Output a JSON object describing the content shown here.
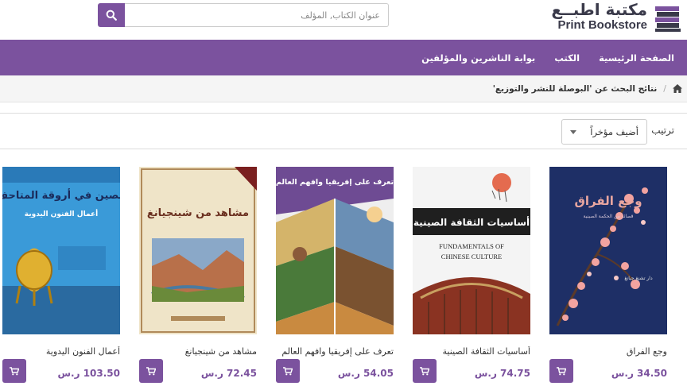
{
  "header": {
    "logo_ar": "مكتبة اطبــع",
    "logo_en": "Print Bookstore",
    "search_placeholder": "عنوان الكتاب, المؤلف"
  },
  "nav": {
    "items": [
      {
        "label": "الصفحة الرئيسية"
      },
      {
        "label": "الكتب"
      },
      {
        "label": "بوابة الناشرين والمؤلفين"
      }
    ]
  },
  "breadcrumb": {
    "current": "نتائج البحث عن 'البوصلة للنشر والتوزيع'"
  },
  "sort": {
    "label": "ترتيب",
    "selected": "أضيف مؤخراً"
  },
  "products": [
    {
      "title": "وجع الفراق",
      "price": "34.50 ر.س",
      "cover_title": "وجع الفراق",
      "cover_subtitle": "قصائد من الحكمة الصينية",
      "cover_author": "دار تشنغ جيانغ",
      "cover_color": "#1e2f66"
    },
    {
      "title": "أساسيات الثقافة الصينية",
      "price": "74.75 ر.س",
      "cover_title": "أساسيات الثقافة الصينية",
      "cover_en": "FUNDAMENTALS OF CHINESE CULTURE",
      "cover_color": "#f4f4f4"
    },
    {
      "title": "تعرف على إفريقيا وافهم العالم",
      "price": "54.05 ر.س",
      "cover_title": "تعرف على إفريقيا وافهم العالم",
      "cover_color": "#6e4b93"
    },
    {
      "title": "مشاهد من شينجيانغ",
      "price": "72.45 ر.س",
      "cover_title": "مشاهد من شينجيانغ",
      "cover_color": "#efe4c8"
    },
    {
      "title": "أعمال الفنون اليدوية",
      "price": "103.50 ر.س",
      "cover_title": "الصين في أروقة المتاحف",
      "cover_subtitle": "أعمال الفنون اليدوية",
      "cover_color": "#3a9ad8"
    }
  ],
  "colors": {
    "brand": "#7b529e",
    "breadcrumb_bg": "#f5f5f5"
  }
}
